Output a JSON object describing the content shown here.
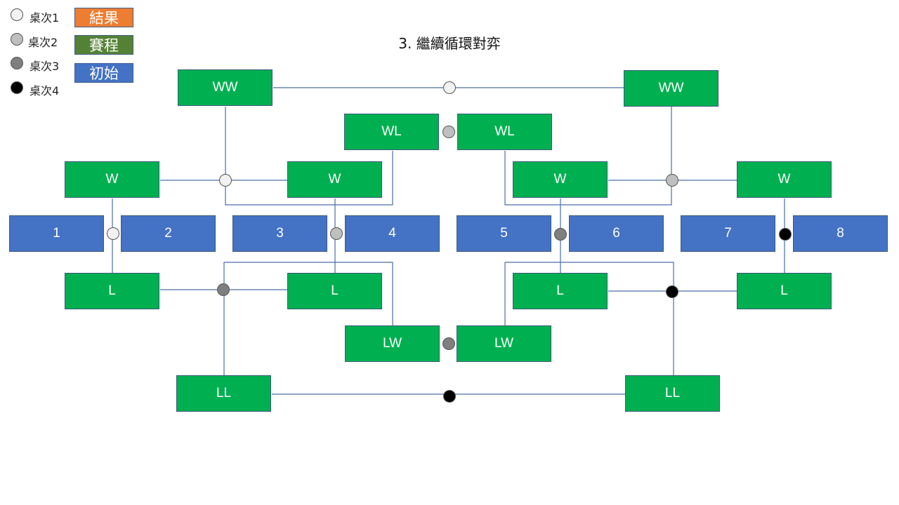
{
  "title": "3. 繼續循環對弈",
  "colors": {
    "result": "#ed7d31",
    "schedule_legend": "#548235",
    "initial": "#4472c4",
    "match": "#00b050",
    "line": "#4a6fa5",
    "table1": "#f2f2f2",
    "table2": "#bfbfbf",
    "table3": "#7f7f7f",
    "table4": "#000000"
  },
  "legend": {
    "tables": [
      {
        "label": "桌次1",
        "color": "#f2f2f2"
      },
      {
        "label": "桌次2",
        "color": "#bfbfbf"
      },
      {
        "label": "桌次3",
        "color": "#7f7f7f"
      },
      {
        "label": "桌次4",
        "color": "#000000"
      }
    ],
    "boxes": [
      {
        "label": "結果",
        "color": "#ed7d31"
      },
      {
        "label": "賽程",
        "color": "#548235"
      },
      {
        "label": "初始",
        "color": "#4472c4"
      }
    ]
  },
  "nodes": {
    "initial": [
      "1",
      "2",
      "3",
      "4",
      "5",
      "6",
      "7",
      "8"
    ],
    "r1_winners": [
      "W",
      "W",
      "W",
      "W"
    ],
    "r1_losers": [
      "L",
      "L",
      "L",
      "L"
    ],
    "r2_ww": [
      "WW",
      "WW"
    ],
    "r2_wl": [
      "WL",
      "WL"
    ],
    "r2_lw": [
      "LW",
      "LW"
    ],
    "r2_ll": [
      "LL",
      "LL"
    ]
  }
}
